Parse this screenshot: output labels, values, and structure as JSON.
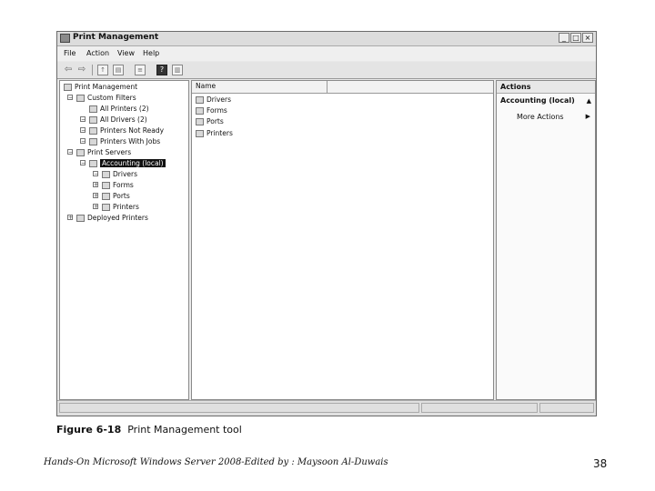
{
  "window": {
    "title": "Print Management",
    "menu": [
      "File",
      "Action",
      "View",
      "Help"
    ]
  },
  "tree": [
    {
      "label": "Print Management",
      "icon": "printer-management-icon",
      "exp": ""
    },
    {
      "label": "Custom Filters",
      "icon": "filter-folder-icon",
      "exp": "−"
    },
    {
      "label": "All Printers (2)",
      "icon": "filter-icon",
      "exp": ""
    },
    {
      "label": "All Drivers (2)",
      "icon": "filter-icon",
      "exp": "−"
    },
    {
      "label": "Printers Not Ready",
      "icon": "filter-icon",
      "exp": "−"
    },
    {
      "label": "Printers With Jobs",
      "icon": "filter-icon",
      "exp": "−"
    },
    {
      "label": "Print Servers",
      "icon": "servers-icon",
      "exp": "−"
    },
    {
      "label": "Accounting (local)",
      "icon": "server-icon",
      "exp": "−",
      "selected": true
    },
    {
      "label": "Drivers",
      "icon": "drivers-icon",
      "exp": "−"
    },
    {
      "label": "Forms",
      "icon": "forms-icon",
      "exp": "+"
    },
    {
      "label": "Ports",
      "icon": "ports-icon",
      "exp": "+"
    },
    {
      "label": "Printers",
      "icon": "printer-icon",
      "exp": "+"
    },
    {
      "label": "Deployed Printers",
      "icon": "deployed-printers-icon",
      "exp": "+"
    }
  ],
  "list": {
    "column_header": "Name",
    "items": [
      {
        "label": "Drivers",
        "icon": "drivers-icon"
      },
      {
        "label": "Forms",
        "icon": "forms-icon"
      },
      {
        "label": "Ports",
        "icon": "ports-icon"
      },
      {
        "label": "Printers",
        "icon": "printer-icon"
      }
    ]
  },
  "actions": {
    "header": "Actions",
    "section": "Accounting (local)",
    "more": "More Actions"
  },
  "caption": {
    "figure": "Figure 6-18",
    "text": "Print Management tool"
  },
  "footer": "Hands-On Microsoft Windows Server 2008-Edited by : Maysoon Al-Duwais",
  "page_number": "38"
}
